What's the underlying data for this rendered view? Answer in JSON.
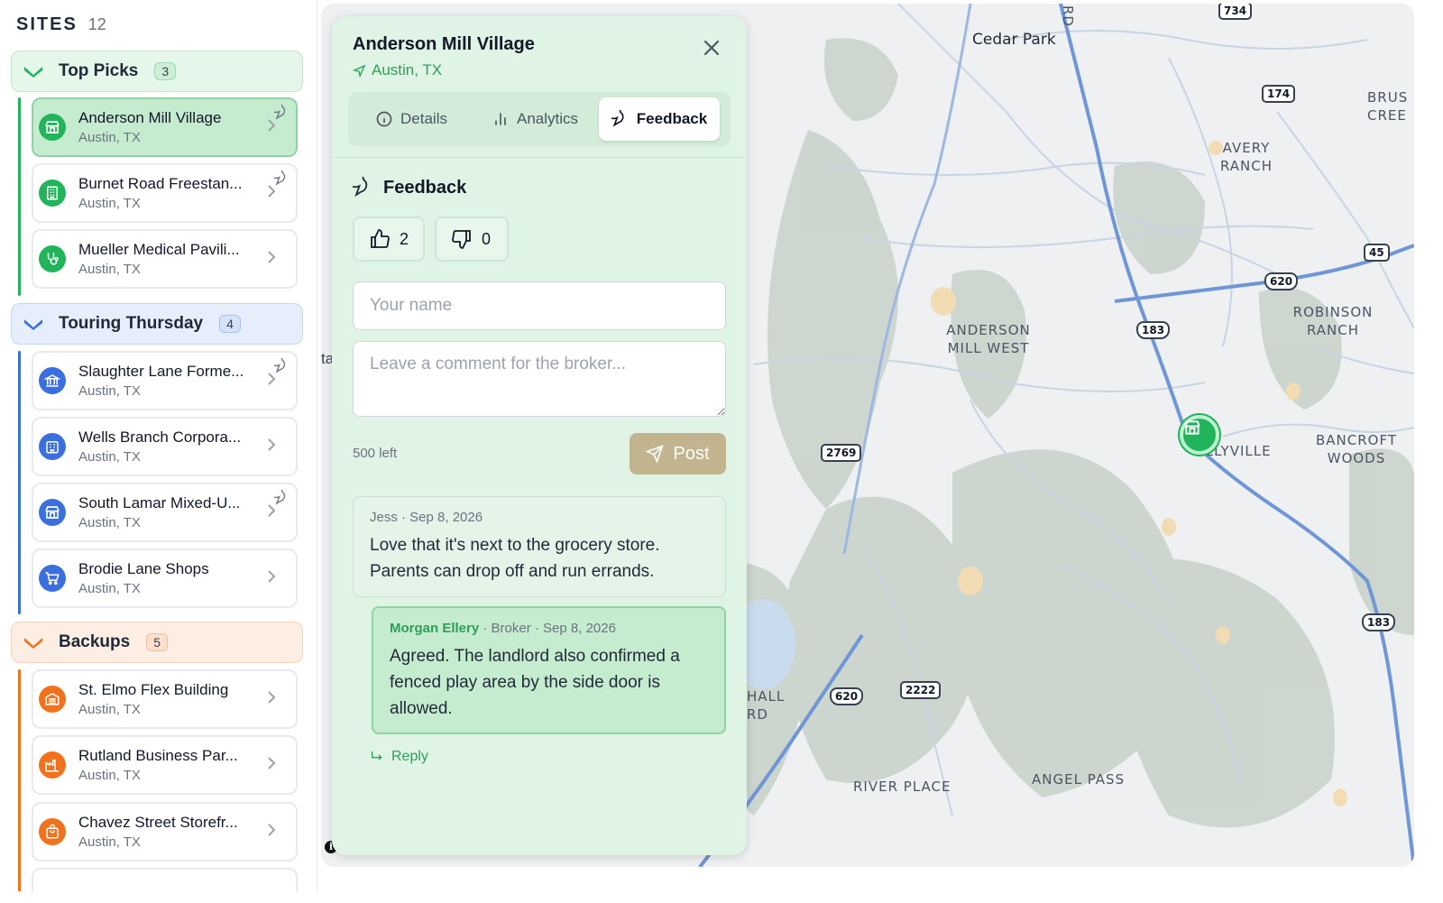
{
  "sidebar": {
    "title": "SITES",
    "count": "12",
    "groups": [
      {
        "name": "Top Picks",
        "count": "3",
        "color": "#22b45a",
        "sites": [
          {
            "name": "Anderson Mill Village",
            "city": "Austin, TX",
            "icon": "storefront-icon",
            "comments": true,
            "active": true
          },
          {
            "name": "Burnet Road Freestan...",
            "city": "Austin, TX",
            "icon": "building-icon",
            "comments": true
          },
          {
            "name": "Mueller Medical Pavili...",
            "city": "Austin, TX",
            "icon": "stethoscope-icon",
            "comments": false
          }
        ]
      },
      {
        "name": "Touring Thursday",
        "count": "4",
        "color": "#3b6fe0",
        "sites": [
          {
            "name": "Slaughter Lane Forme...",
            "city": "Austin, TX",
            "icon": "bank-icon",
            "comments": true
          },
          {
            "name": "Wells Branch Corpora...",
            "city": "Austin, TX",
            "icon": "office-building-icon",
            "comments": false
          },
          {
            "name": "South Lamar Mixed-U...",
            "city": "Austin, TX",
            "icon": "storefront-icon",
            "comments": true
          },
          {
            "name": "Brodie Lane Shops",
            "city": "Austin, TX",
            "icon": "shopping-cart-icon",
            "comments": false
          }
        ]
      },
      {
        "name": "Backups",
        "count": "5",
        "color": "#f2711c",
        "sites": [
          {
            "name": "St. Elmo Flex Building",
            "city": "Austin, TX",
            "icon": "warehouse-icon",
            "comments": false
          },
          {
            "name": "Rutland Business Par...",
            "city": "Austin, TX",
            "icon": "factory-icon",
            "comments": false
          },
          {
            "name": "Chavez Street Storefr...",
            "city": "Austin, TX",
            "icon": "shopping-bag-icon",
            "comments": false
          }
        ]
      }
    ]
  },
  "map": {
    "labels": {
      "cedar_park": "Cedar Park",
      "rd": "RD",
      "avery_ranch": "AVERY\nRANCH",
      "brushy_creek": "BRUS\nCREE",
      "robinson_ranch": "ROBINSON\nRANCH",
      "anderson_mill_west": "ANDERSON\nMILL WEST",
      "jollyville": "OLLYVILLE",
      "bancroft_woods": "BANCROFT\nWOODS",
      "hall_rd": "HALL\nRD",
      "river_place": "RIVER PLACE",
      "angel_pass": "ANGEL PASS",
      "ta": "ta"
    },
    "shields": {
      "s734": "734",
      "s174": "174",
      "s45": "45",
      "s620a": "620",
      "s183a": "183",
      "s2769": "2769",
      "s620b": "620",
      "s2222": "2222",
      "s183b": "183"
    }
  },
  "panel": {
    "title": "Anderson Mill Village",
    "location": "Austin, TX",
    "tabs": {
      "details": "Details",
      "analytics": "Analytics",
      "feedback": "Feedback"
    },
    "section_title": "Feedback",
    "thumbs_up": "2",
    "thumbs_down": "0",
    "name_placeholder": "Your name",
    "comment_placeholder": "Leave a comment for the broker...",
    "chars_left": "500 left",
    "post_label": "Post",
    "comment": {
      "meta": "Jess · Sep 8, 2026",
      "body": "Love that it's next to the grocery store. Parents can drop off and run errands."
    },
    "reply": {
      "author": "Morgan Ellery",
      "meta": " · Broker · Sep 8, 2026",
      "body": "Agreed. The landlord also confirmed a fenced play area by the side door is allowed."
    },
    "reply_label": "Reply"
  }
}
